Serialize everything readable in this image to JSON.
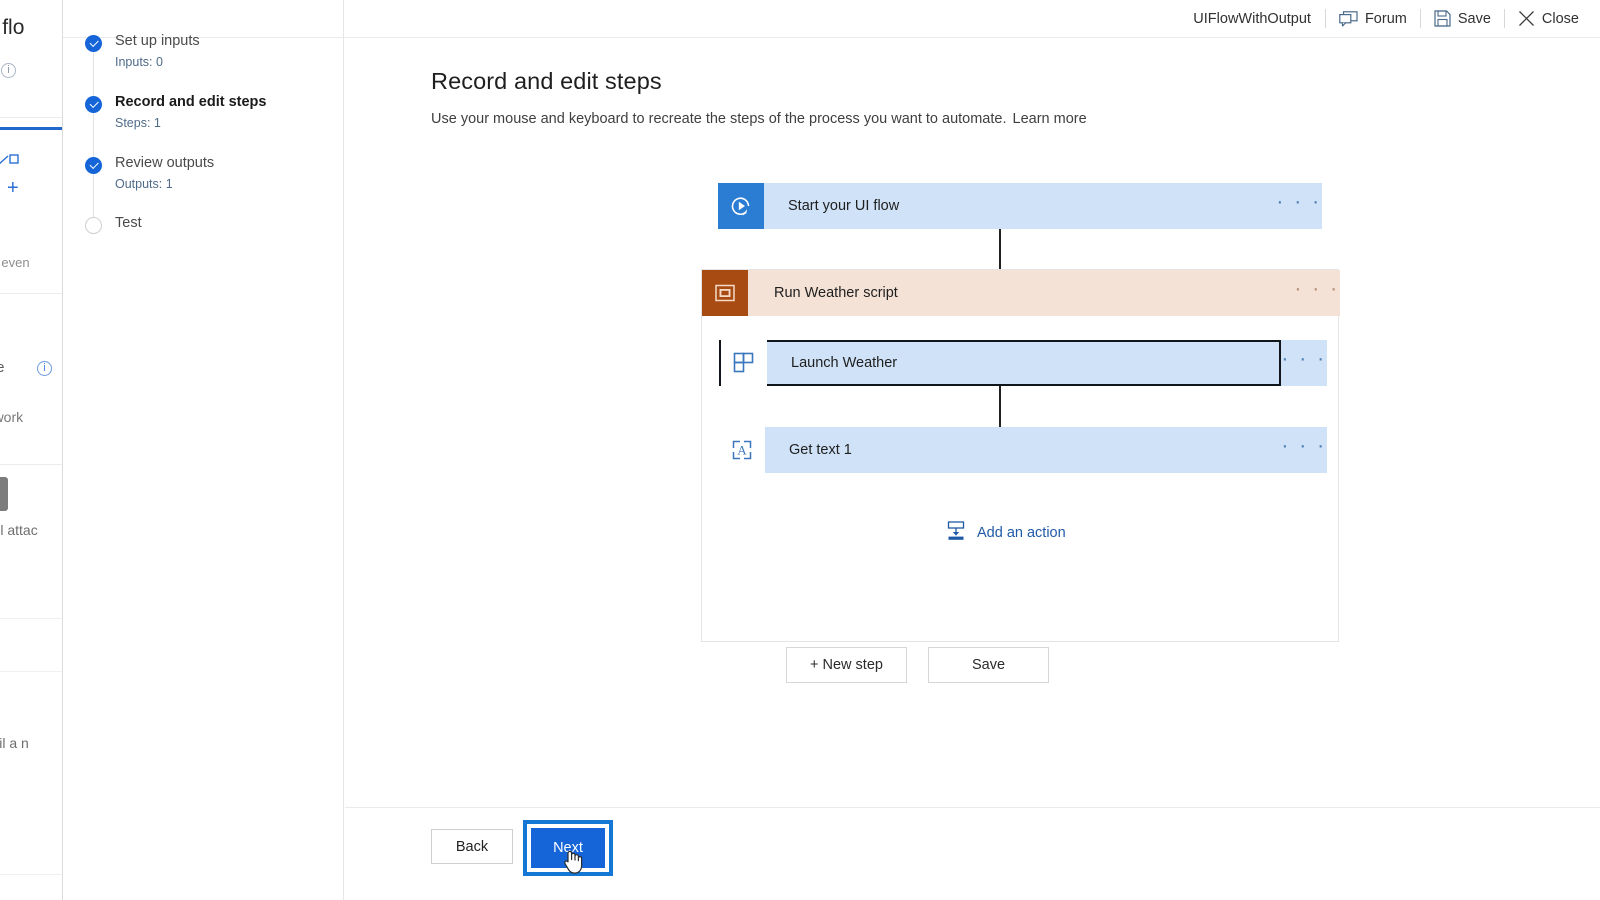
{
  "background_page": {
    "title_fragment": "ake a flo",
    "text_fragments": [
      "gnated even",
      "blate",
      "te work",
      "email attac",
      "email a n"
    ],
    "plus_icon": "plus-icon",
    "info_icon": "info-icon"
  },
  "header": {
    "flow_name": "UIFlowWithOutput",
    "forum_label": "Forum",
    "forum_icon": "chat-bubble-icon",
    "save_label": "Save",
    "save_icon": "floppy-disk-icon",
    "close_label": "Close",
    "close_icon": "close-x-icon"
  },
  "steps": [
    {
      "title": "Set up inputs",
      "sub": "Inputs: 0",
      "state": "done",
      "current": false
    },
    {
      "title": "Record and edit steps",
      "sub": "Steps: 1",
      "state": "done",
      "current": true
    },
    {
      "title": "Review outputs",
      "sub": "Outputs: 1",
      "state": "done",
      "current": false
    },
    {
      "title": "Test",
      "sub": "",
      "state": "pending",
      "current": false
    }
  ],
  "main": {
    "title": "Record and edit steps",
    "subtitle": "Use your mouse and keyboard to recreate the steps of the process you want to automate.",
    "learn_more": "Learn more"
  },
  "flow": {
    "trigger": {
      "label": "Start your UI flow",
      "icon": "play-refresh-icon",
      "tile_color": "#2b7cd3",
      "body_color": "#cfe2f7",
      "menu": "· · ·"
    },
    "scope": {
      "label": "Run Weather script",
      "icon": "window-icon",
      "tile_color": "#a84b12",
      "body_color": "#f4e2d6",
      "menu": "· · ·"
    },
    "actions": [
      {
        "label": "Launch Weather",
        "icon": "app-window-layout-icon",
        "body_color": "#cfe2f7",
        "selected": true,
        "menu": "· · ·"
      },
      {
        "label": "Get text 1",
        "icon": "text-extract-icon",
        "body_color": "#cfe2f7",
        "selected": false,
        "menu": "· · ·"
      }
    ],
    "add_action": {
      "label": "Add an action",
      "icon": "insert-action-icon",
      "color": "#1f5aa8"
    },
    "buttons": {
      "new_step": "+ New step",
      "save": "Save"
    }
  },
  "footer": {
    "back": "Back",
    "next": "Next",
    "cursor": "pointer-hand-cursor"
  }
}
